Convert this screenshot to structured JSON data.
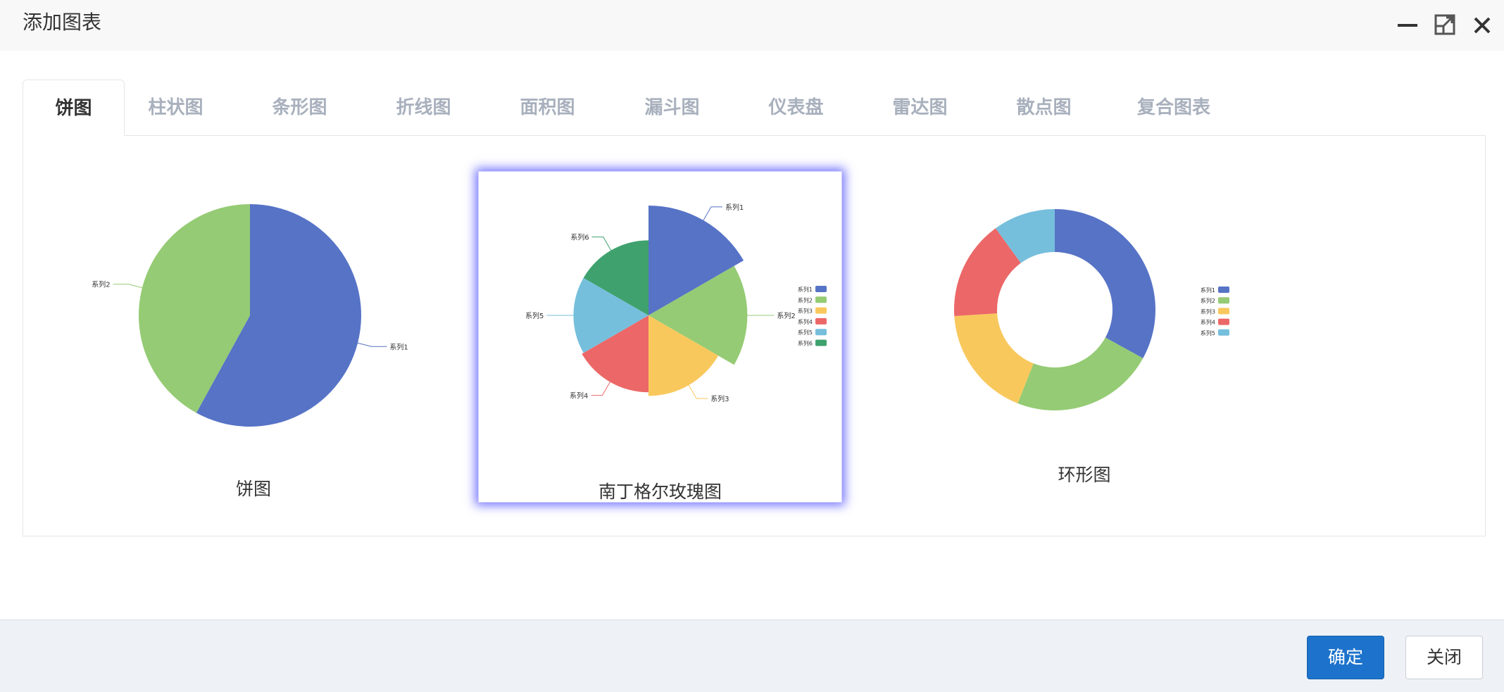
{
  "dialog": {
    "title": "添加图表"
  },
  "tabs": [
    {
      "label": "饼图",
      "active": true
    },
    {
      "label": "柱状图"
    },
    {
      "label": "条形图"
    },
    {
      "label": "折线图"
    },
    {
      "label": "面积图"
    },
    {
      "label": "漏斗图"
    },
    {
      "label": "仪表盘"
    },
    {
      "label": "雷达图"
    },
    {
      "label": "散点图"
    },
    {
      "label": "复合图表"
    }
  ],
  "colors": {
    "blue": "#5673c6",
    "green": "#95cb74",
    "yellow": "#f9c85d",
    "red": "#ec6767",
    "cyan": "#76bfdc",
    "teal": "#3fa16e"
  },
  "cards": {
    "pie": {
      "label": "饼图"
    },
    "rose": {
      "label": "南丁格尔玫瑰图",
      "selected": true
    },
    "ring": {
      "label": "环形图"
    }
  },
  "chart_data": [
    {
      "type": "pie",
      "series": [
        {
          "name": "系列1",
          "value": 58
        },
        {
          "name": "系列2",
          "value": 42
        }
      ]
    },
    {
      "type": "pie",
      "variant": "rose",
      "legend": "right",
      "series": [
        {
          "name": "系列1",
          "value": 6
        },
        {
          "name": "系列2",
          "value": 5.4
        },
        {
          "name": "系列3",
          "value": 4.4
        },
        {
          "name": "系列4",
          "value": 4.2
        },
        {
          "name": "系列5",
          "value": 4.1
        },
        {
          "name": "系列6",
          "value": 4.1
        }
      ]
    },
    {
      "type": "pie",
      "variant": "donut",
      "legend": "right",
      "series": [
        {
          "name": "系列1",
          "value": 33
        },
        {
          "name": "系列2",
          "value": 23
        },
        {
          "name": "系列3",
          "value": 18
        },
        {
          "name": "系列4",
          "value": 16
        },
        {
          "name": "系列5",
          "value": 10
        }
      ]
    }
  ],
  "footer": {
    "confirm_label": "确定",
    "close_label": "关闭"
  }
}
